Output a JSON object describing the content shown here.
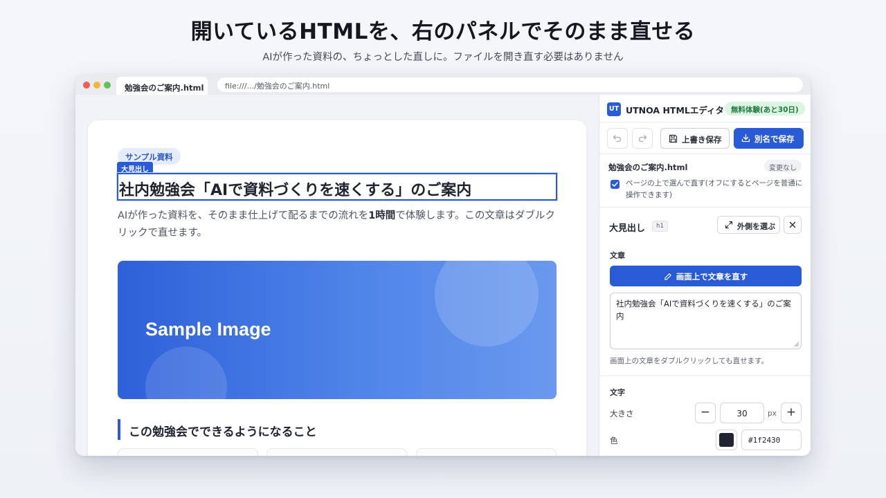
{
  "hero": {
    "title": "開いているHTMLを、右のパネルでそのまま直せる",
    "subtitle": "AIが作った資料の、ちょっとした直しに。ファイルを開き直す必要はありません"
  },
  "browser": {
    "tab_title": "勉強会のご案内.html",
    "url": "file:///.../勉強会のご案内.html"
  },
  "document": {
    "pill": "サンプル資料",
    "selection_tag": "大見出し",
    "h1": "社内勉強会「AIで資料づくりを速くする」のご案内",
    "lead_before": "AIが作った資料を、そのまま仕上げて配るまでの流れを",
    "lead_bold": "1時間",
    "lead_after": "で体験します。この文章はダブルクリックで直せます。",
    "image_label": "Sample Image",
    "h2": "この勉強会でできるようになること"
  },
  "panel": {
    "logo": "UT",
    "app_name": "UTNOA HTMLエディタ",
    "trial_badge": "無料体験(あと30日)",
    "undo_icon": "undo-icon",
    "redo_icon": "redo-icon",
    "overwrite_save": "上書き保存",
    "save_as": "別名で保存",
    "file_name": "勉強会のご案内.html",
    "file_status": "変更なし",
    "select_on_page_checked": true,
    "select_on_page_label": "ページの上で選んで直す(オフにするとページを普通に操作できます)",
    "element_name": "大見出し",
    "element_tag": "h1",
    "select_parent": "外側を選ぶ",
    "text_section": "文章",
    "edit_on_screen": "画面上で文章を直す",
    "text_value": "社内勉強会「AIで資料づくりを速くする」のご案内",
    "text_hint": "画面上の文章をダブルクリックしても直せます。",
    "font_section": "文字",
    "size_label": "大きさ",
    "size_minus": "−",
    "size_value": "30",
    "size_unit": "px",
    "size_plus": "+",
    "color_label": "色",
    "color_value": "#1f2430"
  },
  "colors": {
    "accent": "#2a5bd7",
    "trial_bg": "#dcf5e3",
    "trial_text": "#1f7a3e",
    "text_color_swatch": "#1f2430"
  }
}
